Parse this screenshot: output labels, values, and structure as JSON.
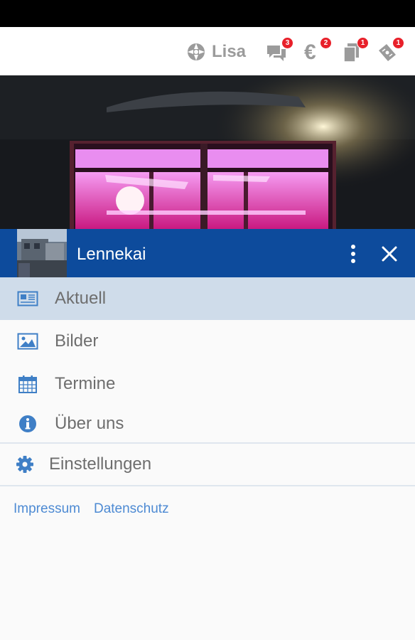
{
  "topbar": {
    "user_name": "Lisa",
    "icons": [
      {
        "name": "chat-icon",
        "badge": "3"
      },
      {
        "name": "euro-icon",
        "label": "€",
        "badge": "2"
      },
      {
        "name": "documents-icon",
        "badge": "1"
      },
      {
        "name": "tickets-icon",
        "badge": "1"
      }
    ]
  },
  "drawer": {
    "title": "Lennekai",
    "menu": [
      {
        "label": "Aktuell",
        "icon": "news-icon",
        "active": true
      },
      {
        "label": "Bilder",
        "icon": "image-icon"
      },
      {
        "label": "Termine",
        "icon": "calendar-icon"
      },
      {
        "label": "Über uns",
        "icon": "info-icon"
      }
    ],
    "settings_label": "Einstellungen",
    "footer": {
      "impressum": "Impressum",
      "datenschutz": "Datenschutz"
    }
  },
  "colors": {
    "header_blue": "#0d4b9c",
    "active_item": "#cfdcea",
    "icon_blue": "#3f7fc6",
    "badge_red": "#e8202a",
    "link_blue": "#4d8ad3"
  }
}
